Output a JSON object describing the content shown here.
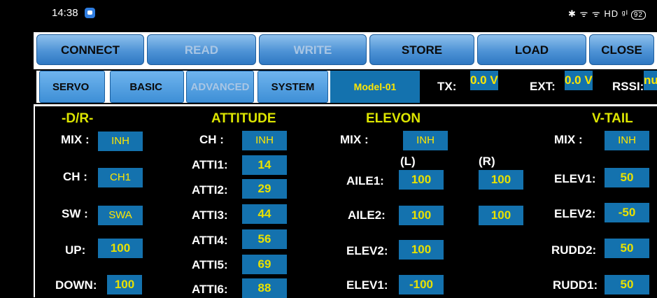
{
  "status": {
    "time": "14:38",
    "right_text": "✱ ᯤ ᯤ HD ᵍᴵ",
    "battery": "92"
  },
  "top_buttons": [
    {
      "label": "CONNECT",
      "enabled": true
    },
    {
      "label": "READ",
      "enabled": false
    },
    {
      "label": "WRITE",
      "enabled": false
    },
    {
      "label": "STORE",
      "enabled": true
    },
    {
      "label": "LOAD",
      "enabled": true
    },
    {
      "label": "CLOSE",
      "enabled": true
    }
  ],
  "tabs": [
    {
      "label": "SERVO",
      "enabled": true
    },
    {
      "label": "BASIC",
      "enabled": true
    },
    {
      "label": "ADVANCED",
      "enabled": false
    },
    {
      "label": "SYSTEM",
      "enabled": true
    }
  ],
  "info": {
    "model": "Model-01",
    "tx_label": "TX:",
    "tx_value": "0.0 V",
    "ext_label": "EXT:",
    "ext_value": "0.0 V",
    "rssi_label": "RSSI:",
    "rssi_value": "nul"
  },
  "dr": {
    "title": "-D/R-",
    "mix_label": "MIX :",
    "mix": "INH",
    "ch_label": "CH :",
    "ch": "CH1",
    "sw_label": "SW :",
    "sw": "SWA",
    "up_label": "UP:",
    "up": "100",
    "down_label": "DOWN:",
    "down": "100"
  },
  "attitude": {
    "title": "ATTITUDE",
    "ch_label": "CH :",
    "ch": "INH",
    "rows": [
      {
        "label": "ATTI1:",
        "value": "14"
      },
      {
        "label": "ATTI2:",
        "value": "29"
      },
      {
        "label": "ATTI3:",
        "value": "44"
      },
      {
        "label": "ATTI4:",
        "value": "56"
      },
      {
        "label": "ATTI5:",
        "value": "69"
      },
      {
        "label": "ATTI6:",
        "value": "88"
      }
    ]
  },
  "elevon": {
    "title": "ELEVON",
    "mix_label": "MIX :",
    "mix": "INH",
    "left": "(L)",
    "right": "(R)",
    "aile1_label": "AILE1:",
    "aile1_l": "100",
    "aile1_r": "100",
    "aile2_label": "AILE2:",
    "aile2_l": "100",
    "aile2_r": "100",
    "elev2_label": "ELEV2:",
    "elev2": "100",
    "elev1_label": "ELEV1:",
    "elev1": "-100"
  },
  "vtail": {
    "title": "V-TAIL",
    "mix_label": "MIX :",
    "mix": "INH",
    "elev1_label": "ELEV1:",
    "elev1": "50",
    "elev2_label": "ELEV2:",
    "elev2": "-50",
    "rudd2_label": "RUDD2:",
    "rudd2": "50",
    "rudd1_label": "RUDD1:",
    "rudd1": "50"
  }
}
